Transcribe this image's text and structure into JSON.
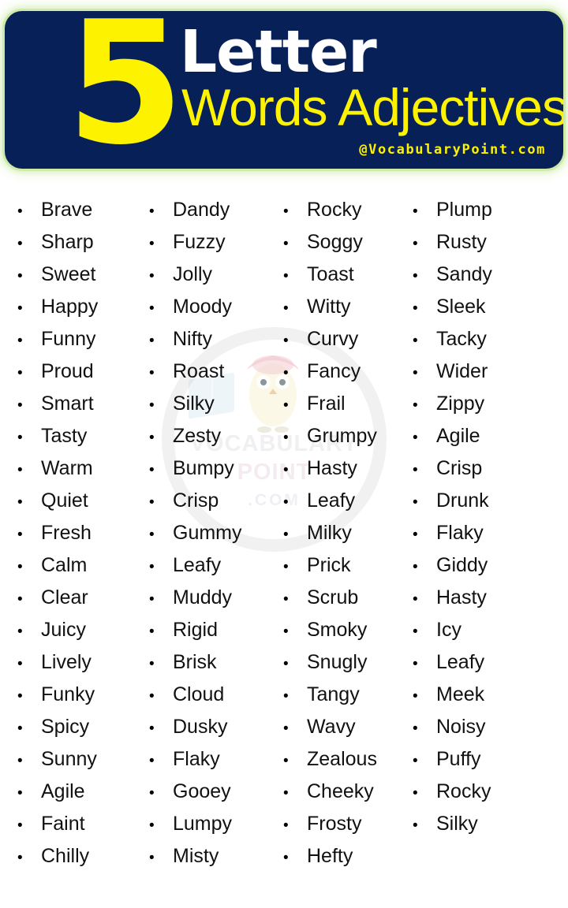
{
  "header": {
    "number": "5",
    "line1": "Letter",
    "line2": "Words Adjectives",
    "site": "@VocabularyPoint.com",
    "bg_color": "#072058",
    "accent_color": "#fdf200",
    "glow_color": "#cfeaa8"
  },
  "watermark": {
    "line1": "VOCABULARY",
    "line2": "POINT",
    "line3": ".COM"
  },
  "list": {
    "bullet": "•",
    "columns": [
      {
        "words": [
          "Brave",
          "Sharp",
          "Sweet",
          "Happy",
          "Funny",
          "Proud",
          "Smart",
          "Tasty",
          "Warm",
          "Quiet",
          "Fresh",
          "Calm",
          "Clear",
          "Juicy",
          "Lively",
          "Funky",
          "Spicy",
          "Sunny",
          "Agile",
          "Faint",
          "Chilly"
        ]
      },
      {
        "words": [
          "Dandy",
          "Fuzzy",
          "Jolly",
          "Moody",
          "Nifty",
          "Roast",
          "Silky",
          "Zesty",
          "Bumpy",
          "Crisp",
          "Gummy",
          "Leafy",
          "Muddy",
          "Rigid",
          "Brisk",
          "Cloud",
          "Dusky",
          "Flaky",
          "Gooey",
          "Lumpy",
          "Misty"
        ]
      },
      {
        "words": [
          "Rocky",
          "Soggy",
          "Toast",
          "Witty",
          "Curvy",
          "Fancy",
          "Frail",
          "Grumpy",
          "Hasty",
          "Leafy",
          "Milky",
          "Prick",
          "Scrub",
          "Smoky",
          "Snugly",
          "Tangy",
          "Wavy",
          "Zealous",
          "Cheeky",
          "Frosty",
          "Hefty"
        ]
      },
      {
        "words": [
          "Plump",
          "Rusty",
          "Sandy",
          "Sleek",
          "Tacky",
          "Wider",
          "Zippy",
          "Agile",
          "Crisp",
          "Drunk",
          "Flaky",
          "Giddy",
          "Hasty",
          "Icy",
          "Leafy",
          "Meek",
          "Noisy",
          "Puffy",
          "Rocky",
          "Silky"
        ]
      }
    ]
  }
}
